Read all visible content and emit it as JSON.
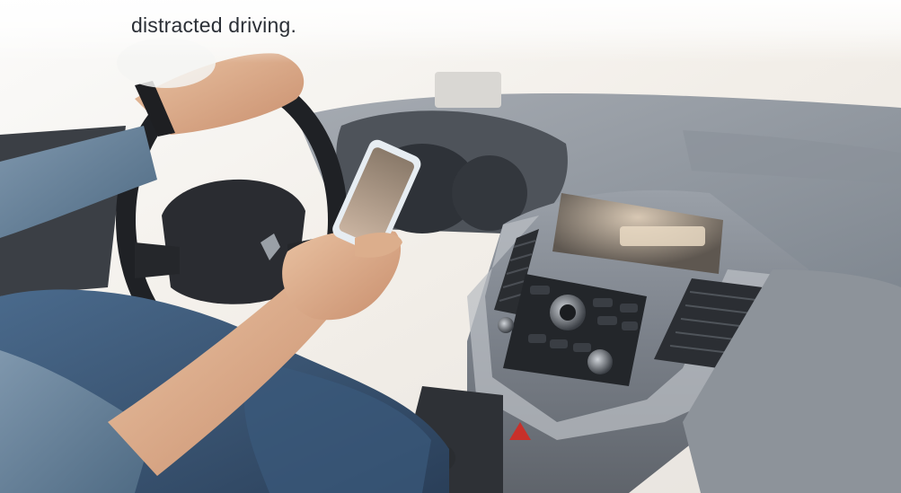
{
  "caption": {
    "line": "distracted driving."
  }
}
